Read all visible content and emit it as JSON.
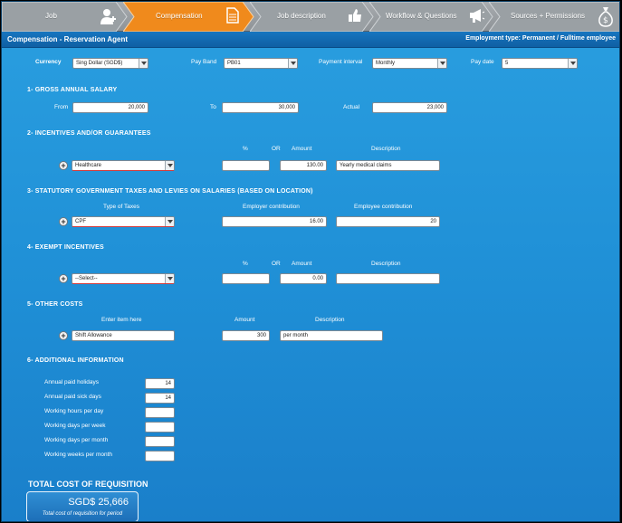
{
  "steps": [
    {
      "label": "Job",
      "icon": "add-user-icon"
    },
    {
      "label": "Compensation",
      "icon": "document-icon"
    },
    {
      "label": "Job description",
      "icon": "thumbs-up-icon"
    },
    {
      "label": "Workflow & Questions",
      "icon": "megaphone-icon"
    },
    {
      "label": "Sources + Permissions",
      "icon": "money-bag-icon"
    }
  ],
  "header": {
    "title": "Compensation - Reservation Agent",
    "employment": "Employment type:  Permanent / Fulltime employee"
  },
  "top": {
    "currency_label": "Currency",
    "currency_value": "Sing Dollar (SGD$)",
    "payband_label": "Pay Band",
    "payband_value": "PB01",
    "interval_label": "Payment interval",
    "interval_value": "Monthly",
    "paydate_label": "Pay date",
    "paydate_value": "5"
  },
  "s1": {
    "title": "1- GROSS ANNUAL SALARY",
    "from_label": "From",
    "from_value": "20,000",
    "to_label": "To",
    "to_value": "30,000",
    "actual_label": "Actual",
    "actual_value": "23,000"
  },
  "s2": {
    "title": "2- INCENTIVES AND/OR GUARANTEES",
    "pct_label": "%",
    "or_label": "OR",
    "amount_label": "Amount",
    "desc_label": "Description",
    "type_value": "Healthcare",
    "pct_value": "",
    "amount_value": "130.00",
    "desc_value": "Yearly medical claims"
  },
  "s3": {
    "title": "3- STATUTORY GOVERNMENT TAXES AND LEVIES ON SALARIES (BASED ON LOCATION)",
    "type_label": "Type of Taxes",
    "employer_label": "Employer contribution",
    "employee_label": "Employee contribution",
    "type_value": "CPF",
    "employer_value": "16.00",
    "employee_value": "20"
  },
  "s4": {
    "title": "4- EXEMPT INCENTIVES",
    "pct_label": "%",
    "or_label": "OR",
    "amount_label": "Amount",
    "desc_label": "Description",
    "type_value": "--Select--",
    "pct_value": "",
    "amount_value": "0.00",
    "desc_value": ""
  },
  "s5": {
    "title": "5- OTHER COSTS",
    "item_label": "Enter item here",
    "amount_label": "Amount",
    "desc_label": "Description",
    "item_value": "Shift Allowance",
    "amount_value": "300",
    "desc_value": "per month"
  },
  "s6": {
    "title": "6- ADDITIONAL INFORMATION",
    "rows": [
      {
        "label": "Annual paid holidays",
        "value": "14"
      },
      {
        "label": "Annual paid sick days",
        "value": "14"
      },
      {
        "label": "Working hours per day",
        "value": ""
      },
      {
        "label": "Working days per week",
        "value": ""
      },
      {
        "label": "Working days per month",
        "value": ""
      },
      {
        "label": "Working weeks per month",
        "value": ""
      }
    ]
  },
  "total": {
    "title": "TOTAL COST OF REQUISITION",
    "value": "SGD$ 25,666",
    "caption": "Total cost of requisition for period"
  },
  "colors": {
    "active_step": "#f08a1c",
    "panel": "#2196dc",
    "header": "#1268ad"
  }
}
